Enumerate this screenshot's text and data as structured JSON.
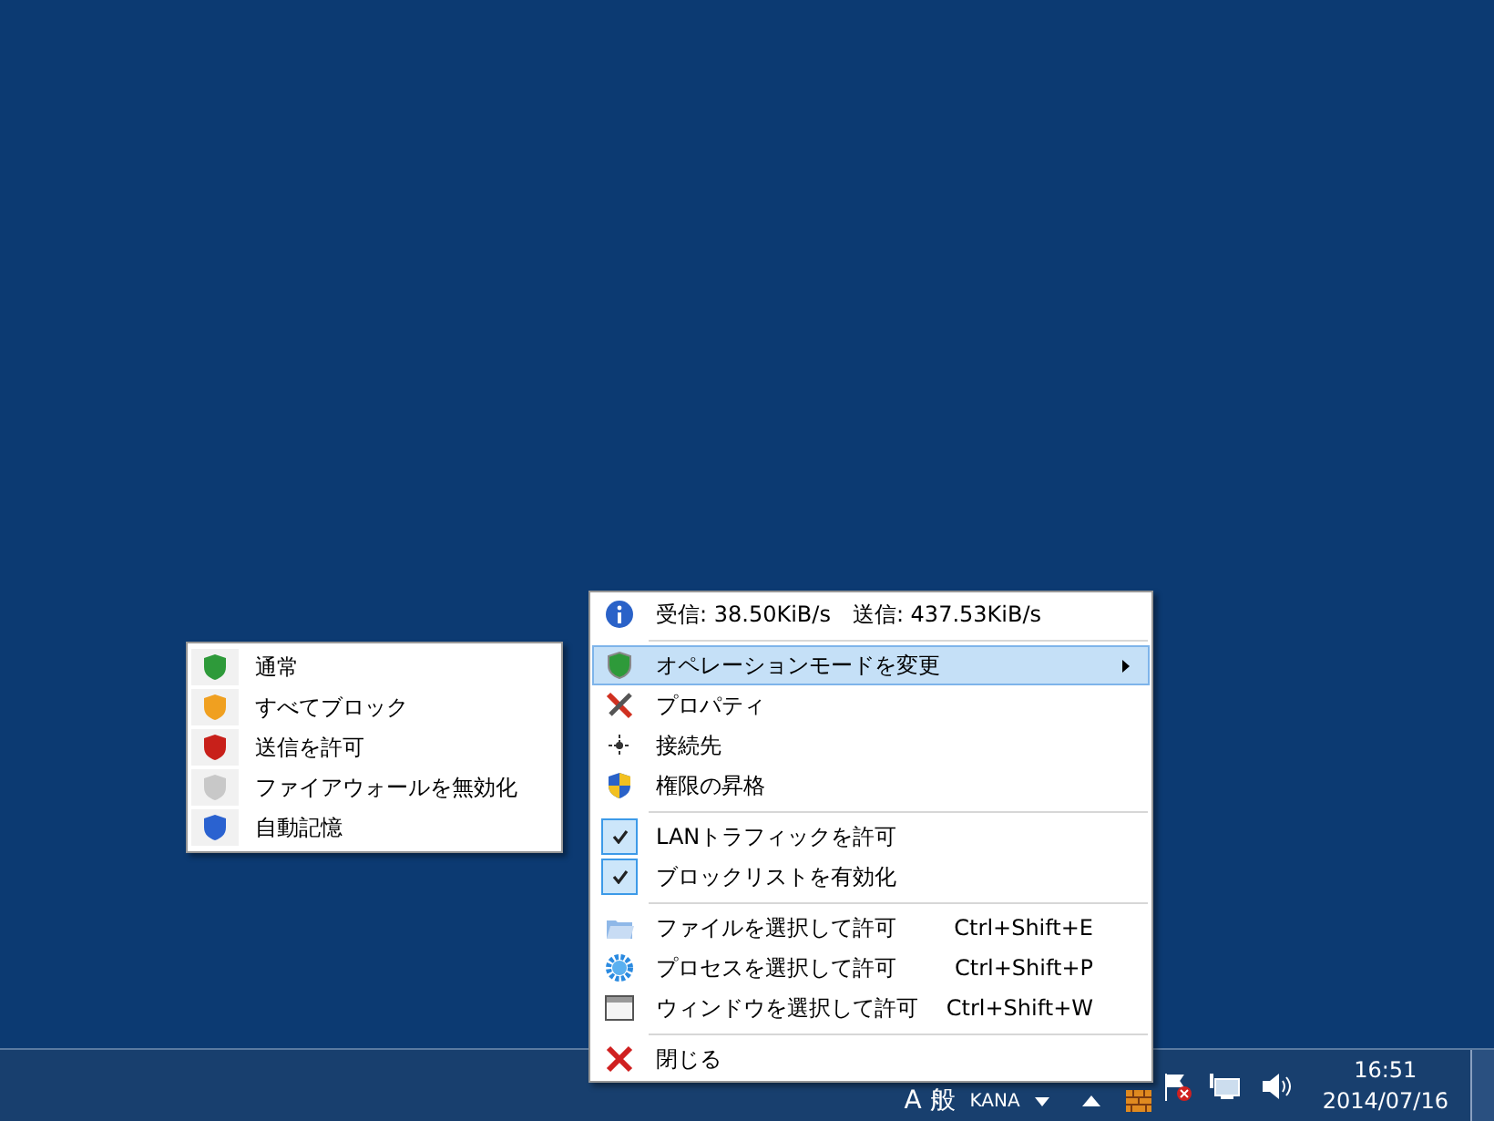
{
  "context_menu": {
    "items": [
      {
        "kind": "info",
        "label": "受信: 38.50KiB/s　送信: 437.53KiB/s",
        "selected": false
      },
      {
        "kind": "separator"
      },
      {
        "kind": "item",
        "label": "オペレーションモードを変更",
        "selected": true,
        "has_submenu": true
      },
      {
        "kind": "item",
        "label": "プロパティ",
        "selected": false
      },
      {
        "kind": "item",
        "label": "接続先",
        "selected": false
      },
      {
        "kind": "item",
        "label": "権限の昇格",
        "selected": false
      },
      {
        "kind": "separator"
      },
      {
        "kind": "check",
        "label": "LANトラフィックを許可",
        "selected": false,
        "checked": true
      },
      {
        "kind": "check",
        "label": "ブロックリストを有効化",
        "selected": false,
        "checked": true
      },
      {
        "kind": "separator"
      },
      {
        "kind": "item",
        "label": "ファイルを選択して許可",
        "shortcut": "Ctrl+Shift+E",
        "selected": false
      },
      {
        "kind": "item",
        "label": "プロセスを選択して許可",
        "shortcut": "Ctrl+Shift+P",
        "selected": false
      },
      {
        "kind": "item",
        "label": "ウィンドウを選択して許可",
        "shortcut": "Ctrl+Shift+W",
        "selected": false
      },
      {
        "kind": "separator"
      },
      {
        "kind": "item",
        "label": "閉じる",
        "selected": false
      }
    ]
  },
  "submenu": {
    "items": [
      {
        "label": "通常",
        "color": "#2e9a3a",
        "selected": false
      },
      {
        "label": "すべてブロック",
        "color": "#f0a020",
        "selected": false
      },
      {
        "label": "送信を許可",
        "color": "#c8201a",
        "selected": false
      },
      {
        "label": "ファイアウォールを無効化",
        "color": "#c8c8c8",
        "selected": false
      },
      {
        "label": "自動記憶",
        "color": "#2a62d0",
        "selected": false
      }
    ]
  },
  "taskbar": {
    "ime": "A 般",
    "ime_mode": "KANA",
    "time": "16:51",
    "date": "2014/07/16"
  }
}
